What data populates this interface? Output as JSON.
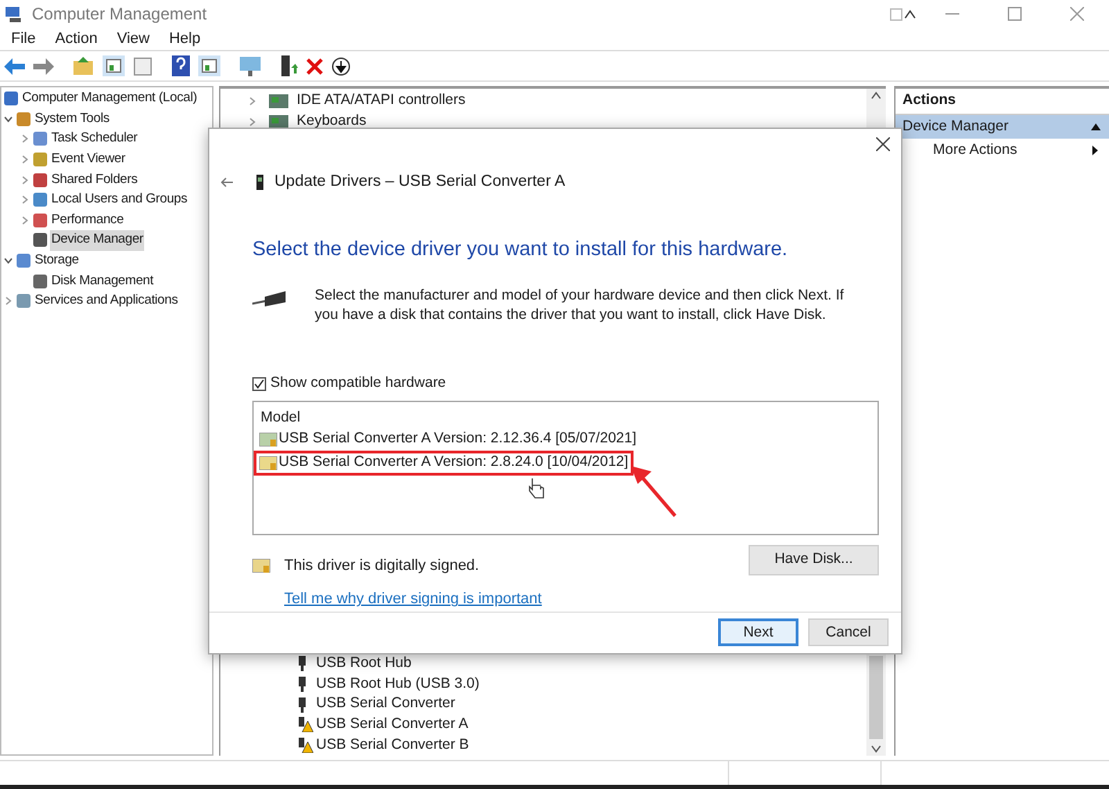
{
  "window": {
    "title": "Computer Management"
  },
  "menu": [
    "File",
    "Action",
    "View",
    "Help"
  ],
  "tree": [
    {
      "label": "Computer Management (Local)",
      "selected": false,
      "children": [
        {
          "label": "System Tools",
          "expanded": true,
          "selected": false,
          "children": [
            {
              "label": "Task Scheduler",
              "expanded": false,
              "selected": false
            },
            {
              "label": "Event Viewer",
              "expanded": false,
              "selected": false
            },
            {
              "label": "Shared Folders",
              "expanded": false,
              "selected": false
            },
            {
              "label": "Local Users and Groups",
              "expanded": false,
              "selected": false
            },
            {
              "label": "Performance",
              "expanded": false,
              "selected": false
            },
            {
              "label": "Device Manager",
              "selected": true
            }
          ]
        },
        {
          "label": "Storage",
          "expanded": true,
          "selected": false,
          "children": [
            {
              "label": "Disk Management",
              "selected": false
            }
          ]
        },
        {
          "label": "Services and Applications",
          "expanded": false,
          "selected": false
        }
      ]
    }
  ],
  "device_list": {
    "top_rows": [
      {
        "label": "IDE ATA/ATAPI controllers",
        "kind": "category"
      },
      {
        "label": "Keyboards",
        "kind": "category"
      }
    ],
    "bottom_rows": [
      {
        "label": "USB Root Hub",
        "kind": "usb"
      },
      {
        "label": "USB Root Hub (USB 3.0)",
        "kind": "usb"
      },
      {
        "label": "USB Serial Converter",
        "kind": "usb"
      },
      {
        "label": "USB Serial Converter A",
        "kind": "warning"
      },
      {
        "label": "USB Serial Converter B",
        "kind": "warning"
      }
    ]
  },
  "actions": {
    "header": "Actions",
    "section": {
      "title": "Device Manager",
      "selected": true
    },
    "items": [
      "More Actions"
    ]
  },
  "dialog": {
    "title": "Update Drivers – USB Serial Converter A",
    "heading": "Select the device driver you want to install for this hardware.",
    "description": "Select the manufacturer and model of your hardware device and then click Next. If you have a disk that contains the driver that you want to install, click Have Disk.",
    "checkbox": {
      "label": "Show compatible hardware",
      "checked": true
    },
    "model_list": {
      "header": "Model",
      "items": [
        {
          "label": "USB Serial Converter A Version: 2.12.36.4 [05/07/2021]",
          "annotated": false
        },
        {
          "label": "USB Serial Converter A Version: 2.8.24.0 [10/04/2012]",
          "annotated": true
        }
      ]
    },
    "signed_text": "This driver is digitally signed.",
    "link": "Tell me why driver signing is important",
    "buttons": [
      {
        "label": "Have Disk...",
        "default": false
      },
      {
        "label": "Next",
        "default": true
      },
      {
        "label": "Cancel",
        "default": false
      }
    ]
  }
}
